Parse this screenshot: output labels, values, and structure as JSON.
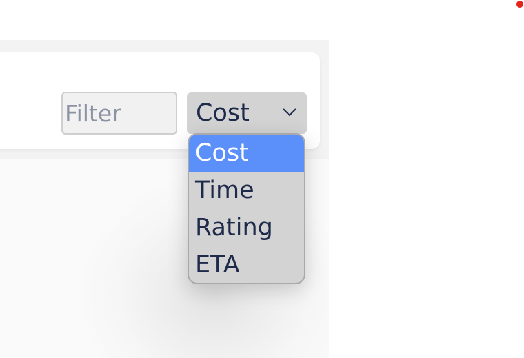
{
  "filter": {
    "placeholder": "Filter",
    "value": ""
  },
  "sort_select": {
    "selected_label": "Cost",
    "chevron_icon": "chevron-down-icon",
    "options": [
      {
        "label": "Cost",
        "selected": true
      },
      {
        "label": "Time",
        "selected": false
      },
      {
        "label": "Rating",
        "selected": false
      },
      {
        "label": "ETA",
        "selected": false
      }
    ]
  },
  "colors": {
    "highlight": "#5b8ffa",
    "text": "#1e2a4a",
    "select_bg": "#d3d3d3",
    "indicator": "#e5231b"
  },
  "indicator": {
    "icon": "red-dot-indicator"
  }
}
